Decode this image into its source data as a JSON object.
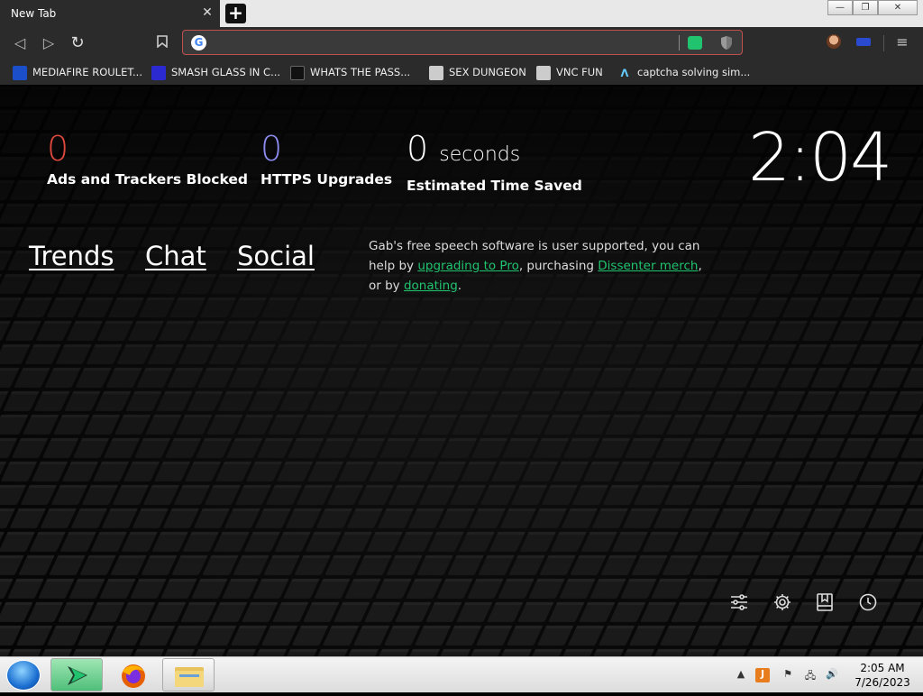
{
  "tab": {
    "title": "New Tab",
    "close": "✕",
    "new_tab": "+"
  },
  "window_controls": {
    "minimize": "—",
    "maximize": "❐",
    "close": "✕"
  },
  "toolbar": {
    "back": "◁",
    "forward": "▷",
    "reload": "↻",
    "bookmark": "🔖",
    "omnibox_value": "",
    "menu": "≡"
  },
  "bookmarks": [
    {
      "label": "MEDIAFIRE ROULET...",
      "icon": "mediafire-icon",
      "color": "#1a4fc9"
    },
    {
      "label": "SMASH GLASS IN C...",
      "icon": "smash-icon",
      "color": "#2a2ad0"
    },
    {
      "label": "WHATS THE PASS...",
      "icon": "lock-icon",
      "color": "#111111"
    },
    {
      "label": "SEX DUNGEON",
      "icon": "cube-icon",
      "color": "#444444"
    },
    {
      "label": "VNC FUN",
      "icon": "cube-icon",
      "color": "#444444"
    },
    {
      "label": "captcha solving sim...",
      "icon": "lambda-icon",
      "color": "#2b2b2b"
    }
  ],
  "stats": [
    {
      "value": "0",
      "unit": "",
      "label": "Ads and Trackers Blocked",
      "color": "#e0483d"
    },
    {
      "value": "0",
      "unit": "",
      "label": "HTTPS Upgrades",
      "color": "#8c8cf0"
    },
    {
      "value": "0",
      "unit": "seconds",
      "label": "Estimated Time Saved",
      "color": "#ffffff"
    }
  ],
  "clock": "2:04",
  "links": {
    "trends": "Trends",
    "chat": "Chat",
    "social": "Social"
  },
  "gab_message": {
    "part1": "Gab's free speech software is user supported, you can help by ",
    "link1": "upgrading to Pro",
    "part2": ", purchasing ",
    "link2": "Dissenter merch",
    "part3": ", or by ",
    "link3": "donating",
    "part4": "."
  },
  "bottom_icons": [
    "customize-icon",
    "gear-icon",
    "bookmarks-icon",
    "history-icon"
  ],
  "taskbar": {
    "time": "2:05 AM",
    "date": "7/26/2023",
    "accent": "#21c36f"
  }
}
